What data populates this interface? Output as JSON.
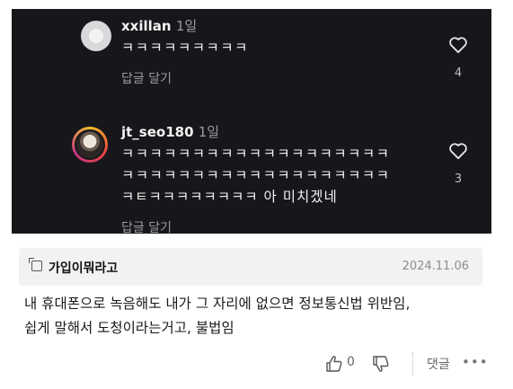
{
  "comments": [
    {
      "username": "xxillan",
      "time": "1일",
      "lines": [
        "ㅋㅋㅋㅋㅋㅋㅋㅋㅋ"
      ],
      "reply_label": "답글 달기",
      "likes": "4",
      "avatar": "default-avatar"
    },
    {
      "username": "jt_seo180",
      "time": "1일",
      "lines": [
        "ㅋㅋㅋㅋㅋㅋㅋㅋㅋㅋㅋㅋㅋㅋㅋㅋㅋㅋㅋ",
        "ㅋㅋㅋㅋㅋㅋㅋㅋㅋㅋㅋㅋㅋㅋㅋㅋㅋㅋㅋ",
        "ㅋㅌㅋㅋㅋㅋㅋㅋㅋㅋ 아 미치겠네"
      ],
      "reply_label": "답글 달기",
      "likes": "3",
      "avatar": "profile-photo-with-story-ring"
    }
  ],
  "post": {
    "board_icon": "board-icon",
    "board_name": "가입이뭐라고",
    "date": "2024.11.06",
    "body_lines": [
      "내 휴대폰으로 녹음해도 내가 그 자리에 없으면 정보통신법 위반임,",
      "쉽게 말해서 도청이라는거고, 불법임"
    ],
    "like_count": "0",
    "reply_label": "댓글",
    "more_label": "•••"
  },
  "colors": {
    "dark_bg": "#17171b",
    "post_head_bg": "#f2f2f2"
  }
}
